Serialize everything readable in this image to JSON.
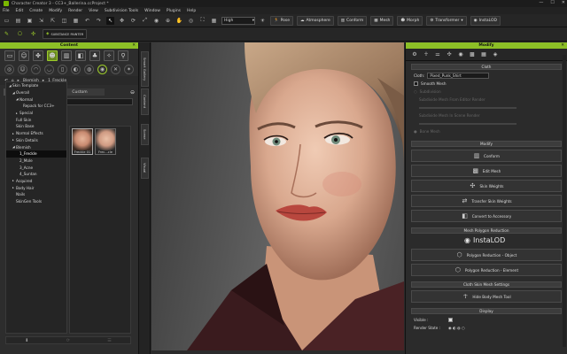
{
  "window": {
    "title": "Character Creator 3 - CC3+_Ballerina.ccProject *",
    "controls": [
      "—",
      "☐",
      "✕"
    ]
  },
  "menu": [
    "File",
    "Edit",
    "Create",
    "Modify",
    "Render",
    "View",
    "Subdivision Tools",
    "Window",
    "Plugins",
    "Help"
  ],
  "toolbar": {
    "quality": "High",
    "pose": "Pose",
    "atmosphere": "Atmosphere",
    "conform": "Conform",
    "mesh": "Mesh",
    "morph": "Morph",
    "transformer": "Transformer",
    "instalod": "InstaLOD"
  },
  "toolbar2": {
    "label": "SUBSTANCE PAINTER"
  },
  "content": {
    "header": "Content",
    "breadcrumb": [
      "Blemish",
      "1_Freckle"
    ],
    "tabs": [
      "Template",
      "Custom"
    ],
    "search_placeholder": "Search",
    "tree": [
      {
        "label": "Skin Template",
        "indent": 0,
        "arrow": "◢"
      },
      {
        "label": "Overall",
        "indent": 1,
        "arrow": "◢"
      },
      {
        "label": "Normal",
        "indent": 2,
        "arrow": "◢"
      },
      {
        "label": "Repack for CC3+",
        "indent": 3,
        "arrow": ""
      },
      {
        "label": "Special",
        "indent": 2,
        "arrow": "▸"
      },
      {
        "label": "Full Skin",
        "indent": 1,
        "arrow": ""
      },
      {
        "label": "Skin Base",
        "indent": 1,
        "arrow": ""
      },
      {
        "label": "Normal Effects",
        "indent": 1,
        "arrow": "▸"
      },
      {
        "label": "Skin Details",
        "indent": 1,
        "arrow": "▸"
      },
      {
        "label": "Blemish",
        "indent": 1,
        "arrow": "◢"
      },
      {
        "label": "1_Freckle",
        "indent": 2,
        "arrow": "",
        "selected": true
      },
      {
        "label": "2_Mole",
        "indent": 2,
        "arrow": ""
      },
      {
        "label": "3_Acne",
        "indent": 2,
        "arrow": ""
      },
      {
        "label": "4_Suntan",
        "indent": 2,
        "arrow": ""
      },
      {
        "label": "Acquired",
        "indent": 1,
        "arrow": "▸"
      },
      {
        "label": "Body Hair",
        "indent": 1,
        "arrow": "▸"
      },
      {
        "label": "Nails",
        "indent": 1,
        "arrow": ""
      },
      {
        "label": "SkinGen Tools",
        "indent": 1,
        "arrow": ""
      }
    ],
    "thumbs": [
      "Freckle 01",
      "Frec...cle"
    ]
  },
  "side_tabs": [
    "Smart Gallery",
    "Content",
    "Scene",
    "Visual"
  ],
  "modify": {
    "header": "Modify",
    "cloth_header": "Cloth",
    "cloth_label": "Cloth:",
    "cloth_value": "Pixed_Punk_Shirt",
    "smooth_mesh": "Smooth Mesh",
    "disabled_rows": [
      "Subdivision",
      "Subdivide Mesh From Editor Render",
      "Subdivide Mesh In Scene Render",
      "Bone Mesh"
    ],
    "modify_header": "Modify",
    "modify_buttons": [
      "Conform",
      "Edit Mesh",
      "Skin Weights",
      "Transfer Skin Weights",
      "Convert to Accessory"
    ],
    "reduction_header": "Mesh Polygon Reduction",
    "instalod_logo": "InstaLOD",
    "reduction_buttons": [
      "Polygon Reduction - Object",
      "Polygon Reduction - Element"
    ],
    "cloth_settings_header": "Cloth Skin Mesh Settings",
    "hide_tool": "Hide Body Mesh Tool",
    "display_header": "Display",
    "visible_label": "Visible :",
    "render_label": "Render State :"
  }
}
